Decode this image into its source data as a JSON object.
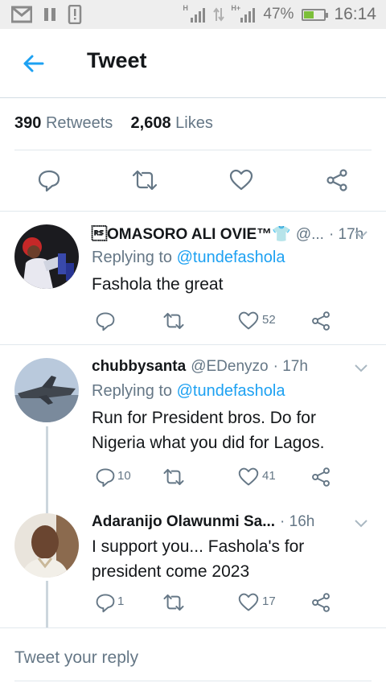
{
  "status_bar": {
    "battery": "47%",
    "time": "16:14",
    "net_tag": "H+"
  },
  "header": {
    "title": "Tweet"
  },
  "stats": {
    "retweets_count": "390",
    "retweets_label": "Retweets",
    "likes_count": "2,608",
    "likes_label": "Likes"
  },
  "replies": [
    {
      "name": "\u001eOMASORO ALI OVIE™👕",
      "handle": "@...",
      "time": "· 17h",
      "replying_label": "Replying to",
      "replying_handle": "@tundefashola",
      "text": "Fashola the great",
      "reply_count": "",
      "retweet_count": "",
      "like_count": "52"
    },
    {
      "name": "chubbysanta",
      "handle": "@EDenyzo",
      "time": "· 17h",
      "replying_label": "Replying to",
      "replying_handle": "@tundefashola",
      "text": "Run for President bros. Do for Nigeria what you did for Lagos.",
      "reply_count": "10",
      "retweet_count": "",
      "like_count": "41"
    },
    {
      "name": "Adaranijo Olawunmi Sa...",
      "handle": "",
      "time": "· 16h",
      "text": "I support you... Fashola's for president come 2023",
      "reply_count": "1",
      "retweet_count": "",
      "like_count": "17"
    }
  ],
  "reply_box": {
    "placeholder": "Tweet your reply"
  },
  "colors": {
    "accent": "#1da1f2",
    "secondary_text": "#657786",
    "icon": "#657786",
    "divider": "#e1e8ed"
  }
}
